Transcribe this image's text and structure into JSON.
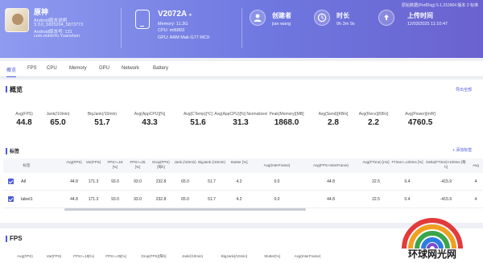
{
  "header": {
    "app": {
      "name": "原神",
      "lines": [
        "Android版本说明",
        "3.3.0_5825204_5873773",
        "Android版本号: 131",
        "com.miHoYo.Yuanshen"
      ]
    },
    "device": {
      "model": "V2072A",
      "model_badge": "●",
      "lines": [
        "Memory: 11.3G",
        "CPU: mt6893",
        "GPU: ARM Mali-G77 MC9"
      ]
    },
    "creator": {
      "label": "创建者",
      "value": "jian wang"
    },
    "duration": {
      "label": "时长",
      "value": "0h 3m 9s"
    },
    "upload_time": {
      "label": "上传时间",
      "value": "12/03/2025 11:10:47"
    },
    "top_right": "原始数据(PerfDog) 5.1.210904 版本 2 标准"
  },
  "tabs": [
    "概览",
    "FPS",
    "CPU",
    "Memory",
    "GPU",
    "Network",
    "Battery"
  ],
  "overview": {
    "title": "概览",
    "export_link": "导出全部",
    "stats": [
      {
        "label": "Avg(FPS)",
        "value": "44.8"
      },
      {
        "label": "Jank(/10min)",
        "value": "65.0"
      },
      {
        "label": "BigJank(/10min)",
        "value": "51.7"
      },
      {
        "label": "Avg(AppCPU)[%]",
        "value": "43.3"
      },
      {
        "label": "Avg(CTemp)[℃]",
        "value": "51.6"
      },
      {
        "label": "Avg(AppCPU)[%] Normalized",
        "value": "31.3"
      },
      {
        "label": "Peak(Memory)[MB]",
        "value": "1868.0"
      },
      {
        "label": "Avg(Send)[KB/s]",
        "value": "2.8"
      },
      {
        "label": "Avg(Recv)[KB/s]",
        "value": "2.2"
      },
      {
        "label": "Avg(Power)[mW]",
        "value": "4760.5"
      }
    ],
    "table_label": "标签",
    "table_link": "+ 添加标签",
    "headers": [
      "标签",
      "Avg(FPS)",
      "Var(FPS)",
      "FPS>=18 [%]",
      "FPS>=25 [%]",
      "Drop(FPS) [每h]",
      "Jank (/10min)",
      "BigJank (/10min)",
      "Stutter [%]",
      "Avg(InterFrame)",
      "Avg(FPS+InterFrame)",
      "Avg(FTime) [ms]",
      "FTime>=100ms [%]",
      "Delta(FTime)>100ms [每h]",
      "Avg"
    ],
    "rows": [
      {
        "name": "All",
        "cells": [
          "44.8",
          "171.3",
          "93.0",
          "93.0",
          "232.8",
          "65.0",
          "51.7",
          "4.2",
          "0.0",
          "44.8",
          "22.5",
          "0.4",
          "-415.9",
          "4"
        ]
      },
      {
        "name": "label1",
        "cells": [
          "44.8",
          "171.3",
          "93.0",
          "93.0",
          "232.8",
          "65.0",
          "51.7",
          "4.2",
          "0.0",
          "44.8",
          "22.5",
          "0.4",
          "-415.9",
          "4"
        ]
      }
    ]
  },
  "fps_section": {
    "title": "FPS",
    "headers": [
      "Avg(FPS)",
      "Var(FPS)",
      "FPS>=18[%]",
      "FPS>=25[%]",
      "Drop(FPS)[每h]",
      "Jank(/10min)",
      "BigJank(/10min)",
      "Stutter[%]",
      "Avg(InterFrame)",
      "Avg(FPS+InterFrame)"
    ]
  },
  "watermark": {
    "text": "环球网光网"
  },
  "colors": {
    "accent": "#4d5bd6",
    "header_start": "#8e9bef",
    "header_end": "#6a62cf"
  }
}
